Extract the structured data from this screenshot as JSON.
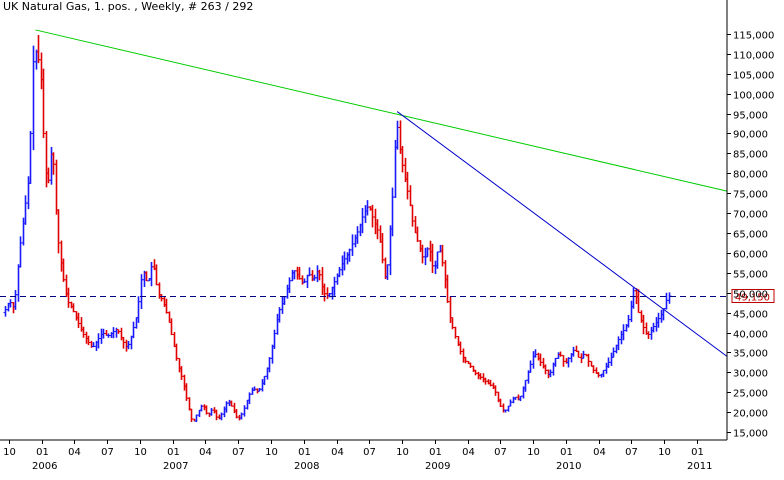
{
  "chart_data": {
    "type": "ohlc",
    "title": "UK Natural Gas, 1. pos. , Weekly, # 263 / 292",
    "y_axis": {
      "position": "right",
      "range": [
        13000,
        120000
      ],
      "ticks": [
        15000,
        20000,
        25000,
        30000,
        35000,
        40000,
        45000,
        50000,
        55000,
        60000,
        65000,
        70000,
        75000,
        80000,
        85000,
        90000,
        95000,
        100000,
        105000,
        110000,
        115000
      ],
      "tick_labels": [
        "15,000",
        "20,000",
        "25,000",
        "30,000",
        "35,000",
        "40,000",
        "45,000",
        "50,000",
        "55,000",
        "60,000",
        "65,000",
        "70,000",
        "75,000",
        "80,000",
        "85,000",
        "90,000",
        "95,000",
        "100,000",
        "105,000",
        "110,000",
        "115,000"
      ]
    },
    "x_axis": {
      "range": [
        "2005-09-20",
        "2011-03-25"
      ],
      "month_ticks": [
        {
          "date": "2005-10-01",
          "label": "10"
        },
        {
          "date": "2006-01-01",
          "label": "01"
        },
        {
          "date": "2006-04-01",
          "label": "04"
        },
        {
          "date": "2006-07-01",
          "label": "07"
        },
        {
          "date": "2006-10-01",
          "label": "10"
        },
        {
          "date": "2007-01-01",
          "label": "01"
        },
        {
          "date": "2007-04-01",
          "label": "04"
        },
        {
          "date": "2007-07-01",
          "label": "07"
        },
        {
          "date": "2007-10-01",
          "label": "10"
        },
        {
          "date": "2008-01-01",
          "label": "01"
        },
        {
          "date": "2008-04-01",
          "label": "04"
        },
        {
          "date": "2008-07-01",
          "label": "07"
        },
        {
          "date": "2008-10-01",
          "label": "10"
        },
        {
          "date": "2009-01-01",
          "label": "01"
        },
        {
          "date": "2009-04-01",
          "label": "04"
        },
        {
          "date": "2009-07-01",
          "label": "07"
        },
        {
          "date": "2009-10-01",
          "label": "10"
        },
        {
          "date": "2010-01-01",
          "label": "01"
        },
        {
          "date": "2010-04-01",
          "label": "04"
        },
        {
          "date": "2010-07-01",
          "label": "07"
        },
        {
          "date": "2010-10-01",
          "label": "10"
        },
        {
          "date": "2011-01-01",
          "label": "01"
        }
      ],
      "year_labels": [
        {
          "date": "2006-01-01",
          "label": "2006"
        },
        {
          "date": "2007-01-01",
          "label": "2007"
        },
        {
          "date": "2008-01-01",
          "label": "2008"
        },
        {
          "date": "2009-01-01",
          "label": "2009"
        },
        {
          "date": "2010-01-01",
          "label": "2010"
        },
        {
          "date": "2011-01-01",
          "label": "2011"
        }
      ]
    },
    "price_points": [
      [
        "2005-09-21",
        45000
      ],
      [
        "2005-10-05",
        48000
      ],
      [
        "2005-10-19",
        46000
      ],
      [
        "2005-11-02",
        60000
      ],
      [
        "2005-11-16",
        70000
      ],
      [
        "2005-11-30",
        80000
      ],
      [
        "2005-12-07",
        100000
      ],
      [
        "2005-12-14",
        116000
      ],
      [
        "2005-12-21",
        105000
      ],
      [
        "2005-12-28",
        112000
      ],
      [
        "2006-01-04",
        95000
      ],
      [
        "2006-01-18",
        75000
      ],
      [
        "2006-02-01",
        88000
      ],
      [
        "2006-02-15",
        65000
      ],
      [
        "2006-03-01",
        55000
      ],
      [
        "2006-03-15",
        48000
      ],
      [
        "2006-03-29",
        46000
      ],
      [
        "2006-04-12",
        43000
      ],
      [
        "2006-04-26",
        40000
      ],
      [
        "2006-05-10",
        38000
      ],
      [
        "2006-05-24",
        36000
      ],
      [
        "2006-06-07",
        38000
      ],
      [
        "2006-06-21",
        40000
      ],
      [
        "2006-07-05",
        39000
      ],
      [
        "2006-07-19",
        40000
      ],
      [
        "2006-08-02",
        41000
      ],
      [
        "2006-08-16",
        38000
      ],
      [
        "2006-08-30",
        36000
      ],
      [
        "2006-09-13",
        40000
      ],
      [
        "2006-09-27",
        45000
      ],
      [
        "2006-10-11",
        56000
      ],
      [
        "2006-10-25",
        52000
      ],
      [
        "2006-11-08",
        58000
      ],
      [
        "2006-11-22",
        50000
      ],
      [
        "2006-12-06",
        48000
      ],
      [
        "2006-12-20",
        44000
      ],
      [
        "2007-01-03",
        38000
      ],
      [
        "2007-01-17",
        32000
      ],
      [
        "2007-01-31",
        28000
      ],
      [
        "2007-02-14",
        22000
      ],
      [
        "2007-02-28",
        17000
      ],
      [
        "2007-03-14",
        20000
      ],
      [
        "2007-03-28",
        22000
      ],
      [
        "2007-04-11",
        19000
      ],
      [
        "2007-04-25",
        21000
      ],
      [
        "2007-05-09",
        18000
      ],
      [
        "2007-05-23",
        20000
      ],
      [
        "2007-06-06",
        23000
      ],
      [
        "2007-06-20",
        21000
      ],
      [
        "2007-07-04",
        18000
      ],
      [
        "2007-07-18",
        20000
      ],
      [
        "2007-08-01",
        24000
      ],
      [
        "2007-08-15",
        26000
      ],
      [
        "2007-08-29",
        25000
      ],
      [
        "2007-09-12",
        28000
      ],
      [
        "2007-09-26",
        32000
      ],
      [
        "2007-10-10",
        38000
      ],
      [
        "2007-10-24",
        45000
      ],
      [
        "2007-11-07",
        48000
      ],
      [
        "2007-11-21",
        52000
      ],
      [
        "2007-12-05",
        56000
      ],
      [
        "2007-12-19",
        54000
      ],
      [
        "2008-01-02",
        52000
      ],
      [
        "2008-01-16",
        55000
      ],
      [
        "2008-01-30",
        53000
      ],
      [
        "2008-02-13",
        56000
      ],
      [
        "2008-02-27",
        50000
      ],
      [
        "2008-03-12",
        49000
      ],
      [
        "2008-03-26",
        52000
      ],
      [
        "2008-04-09",
        55000
      ],
      [
        "2008-04-23",
        58000
      ],
      [
        "2008-05-07",
        60000
      ],
      [
        "2008-05-21",
        63000
      ],
      [
        "2008-06-04",
        66000
      ],
      [
        "2008-06-18",
        70000
      ],
      [
        "2008-07-02",
        72000
      ],
      [
        "2008-07-16",
        68000
      ],
      [
        "2008-07-30",
        65000
      ],
      [
        "2008-08-13",
        56000
      ],
      [
        "2008-08-20",
        52000
      ],
      [
        "2008-08-27",
        62000
      ],
      [
        "2008-09-10",
        78000
      ],
      [
        "2008-09-17",
        95000
      ],
      [
        "2008-09-24",
        88000
      ],
      [
        "2008-10-08",
        80000
      ],
      [
        "2008-10-22",
        74000
      ],
      [
        "2008-11-05",
        66000
      ],
      [
        "2008-11-19",
        62000
      ],
      [
        "2008-12-03",
        58000
      ],
      [
        "2008-12-17",
        62000
      ],
      [
        "2008-12-31",
        55000
      ],
      [
        "2009-01-14",
        62000
      ],
      [
        "2009-01-28",
        56000
      ],
      [
        "2009-02-11",
        45000
      ],
      [
        "2009-02-25",
        40000
      ],
      [
        "2009-03-11",
        36000
      ],
      [
        "2009-03-25",
        33000
      ],
      [
        "2009-04-08",
        32000
      ],
      [
        "2009-04-22",
        30000
      ],
      [
        "2009-05-06",
        29000
      ],
      [
        "2009-05-20",
        28000
      ],
      [
        "2009-06-03",
        27000
      ],
      [
        "2009-06-17",
        26000
      ],
      [
        "2009-07-01",
        22000
      ],
      [
        "2009-07-15",
        20000
      ],
      [
        "2009-07-29",
        22000
      ],
      [
        "2009-08-12",
        24000
      ],
      [
        "2009-08-26",
        23000
      ],
      [
        "2009-09-09",
        27000
      ],
      [
        "2009-09-23",
        31000
      ],
      [
        "2009-10-07",
        35000
      ],
      [
        "2009-10-21",
        33000
      ],
      [
        "2009-11-04",
        31000
      ],
      [
        "2009-11-18",
        29000
      ],
      [
        "2009-12-02",
        33000
      ],
      [
        "2009-12-16",
        35000
      ],
      [
        "2009-12-30",
        32000
      ],
      [
        "2010-01-13",
        34000
      ],
      [
        "2010-01-27",
        36000
      ],
      [
        "2010-02-10",
        33000
      ],
      [
        "2010-02-24",
        35000
      ],
      [
        "2010-03-10",
        32000
      ],
      [
        "2010-03-24",
        30000
      ],
      [
        "2010-04-07",
        29000
      ],
      [
        "2010-04-21",
        31000
      ],
      [
        "2010-05-05",
        33000
      ],
      [
        "2010-05-19",
        36000
      ],
      [
        "2010-06-02",
        39000
      ],
      [
        "2010-06-16",
        41000
      ],
      [
        "2010-06-30",
        44000
      ],
      [
        "2010-07-07",
        49000
      ],
      [
        "2010-07-14",
        52000
      ],
      [
        "2010-07-21",
        46000
      ],
      [
        "2010-08-04",
        42000
      ],
      [
        "2010-08-18",
        39000
      ],
      [
        "2010-09-01",
        41000
      ],
      [
        "2010-09-15",
        43000
      ],
      [
        "2010-09-29",
        45000
      ],
      [
        "2010-10-06",
        47000
      ],
      [
        "2010-10-13",
        49150
      ]
    ],
    "current_price": {
      "value": 49150,
      "label": "49,150"
    },
    "trendlines": [
      {
        "color": "#00cc00",
        "start": [
          "2005-12-14",
          116000
        ],
        "end": [
          "2011-03-25",
          75500
        ]
      },
      {
        "color": "#0000cc",
        "start": [
          "2008-09-17",
          95500
        ],
        "end": [
          "2011-03-25",
          34000
        ]
      }
    ],
    "grid": false
  }
}
